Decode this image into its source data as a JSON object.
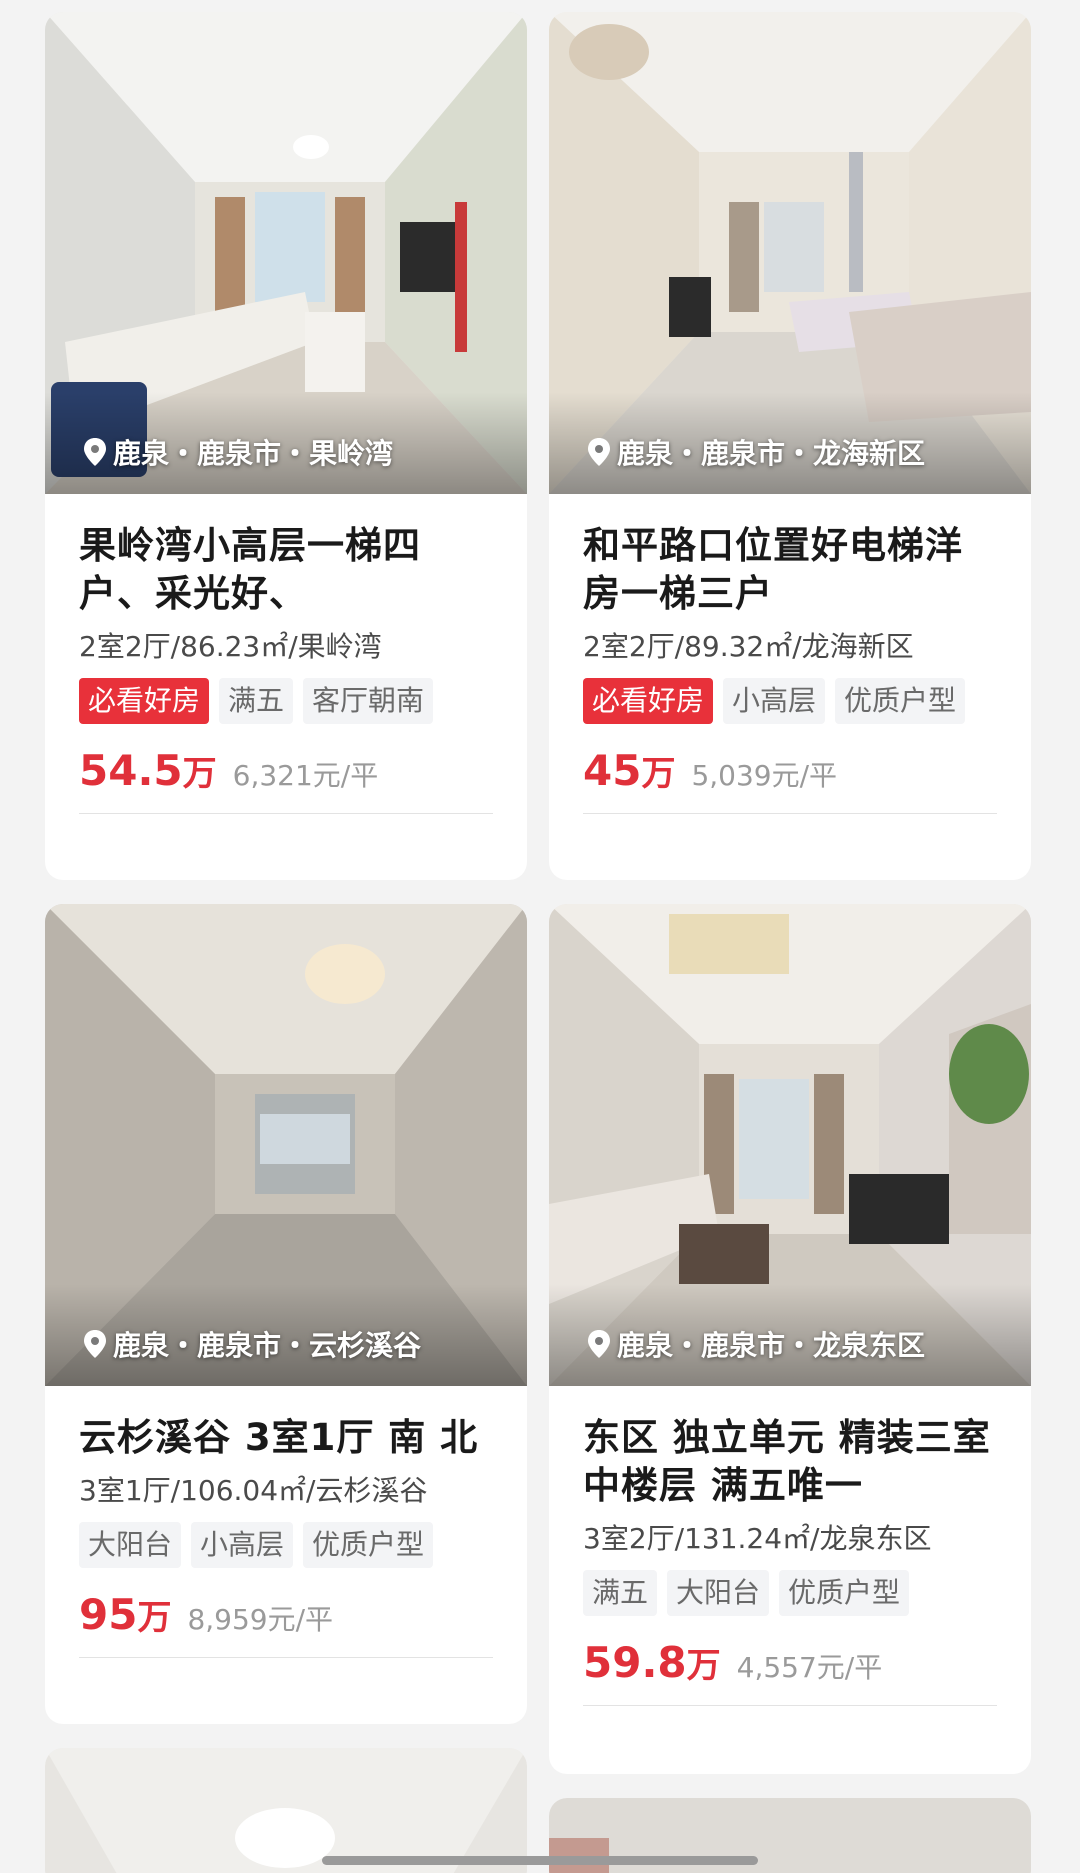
{
  "listings": [
    {
      "location": "鹿泉・鹿泉市・果岭湾",
      "title_line1": "果岭湾小高层一梯四",
      "title_line2": "户、采光好、",
      "meta": "2室2厅/86.23㎡/果岭湾",
      "tags": [
        "必看好房",
        "满五",
        "客厅朝南"
      ],
      "price": "54.5",
      "unit": "万",
      "per_sqm": "6,321元/平"
    },
    {
      "location": "鹿泉・鹿泉市・龙海新区",
      "title_line1": "和平路口位置好电梯洋",
      "title_line2": "房一梯三户",
      "meta": "2室2厅/89.32㎡/龙海新区",
      "tags": [
        "必看好房",
        "小高层",
        "优质户型"
      ],
      "price": "45",
      "unit": "万",
      "per_sqm": "5,039元/平"
    },
    {
      "location": "鹿泉・鹿泉市・云杉溪谷",
      "title_line1": "云杉溪谷 3室1厅 南 北",
      "title_line2": "",
      "meta": "3室1厅/106.04㎡/云杉溪谷",
      "tags": [
        "大阳台",
        "小高层",
        "优质户型"
      ],
      "price": "95",
      "unit": "万",
      "per_sqm": "8,959元/平"
    },
    {
      "location": "鹿泉・鹿泉市・龙泉东区",
      "title_line1": "东区 独立单元 精装三室",
      "title_line2": "中楼层 满五唯一",
      "meta": "3室2厅/131.24㎡/龙泉东区",
      "tags": [
        "满五",
        "大阳台",
        "优质户型"
      ],
      "price": "59.8",
      "unit": "万",
      "per_sqm": "4,557元/平"
    }
  ],
  "colors": {
    "accent_red": "#e0303a",
    "tag_hot_bg": "#e8313a",
    "background": "#f3f3f3"
  }
}
